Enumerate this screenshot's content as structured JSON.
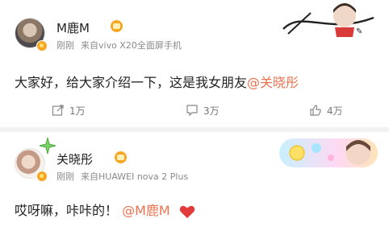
{
  "post1": {
    "username": "M鹿M",
    "meta_time": "刚刚",
    "meta_source": "来自vivo X20全面屏手机",
    "content_text": "大家好，给大家介绍一下，这是我女朋友",
    "content_mention": "@关晓彤",
    "repost_count": "1万",
    "comment_count": "3万",
    "like_count": "4万"
  },
  "post2": {
    "username": "关晓彤",
    "meta_time": "刚刚",
    "meta_source": "来自HUAWEI nova 2 Plus",
    "content_text": "哎呀嘛，咔咔的！",
    "content_mention": "@M鹿M"
  },
  "colors": {
    "mention": "#eb7350",
    "heart": "#e23b3b",
    "badge": "#f6a623"
  },
  "icons": {
    "repost": "repost-icon",
    "comment": "comment-icon",
    "like": "thumbs-up-icon",
    "heart": "heart-icon",
    "verified": "verified-badge-icon",
    "member": "member-crown-icon"
  }
}
